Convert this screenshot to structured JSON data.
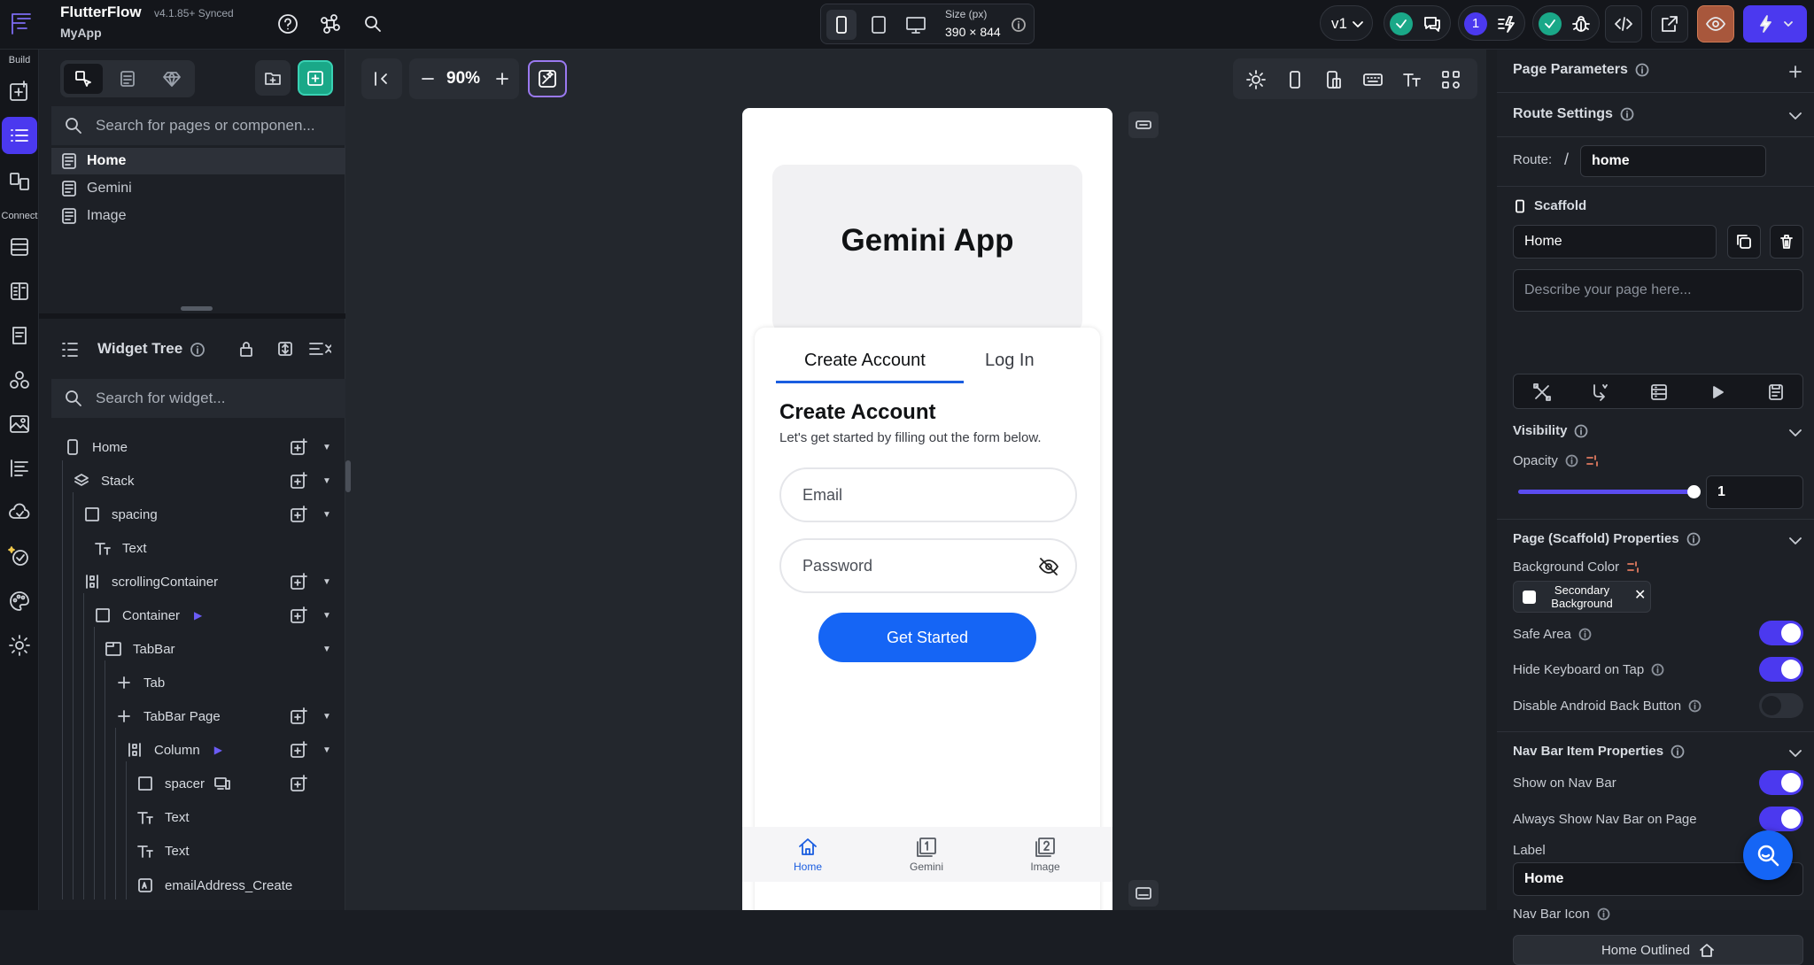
{
  "app": {
    "title": "FlutterFlow",
    "version": "v4.1.85+ Synced",
    "project": "MyApp"
  },
  "topbar": {
    "size_label": "Size (px)",
    "size_value": "390 × 844",
    "version_select": "v1",
    "badge_count": "1"
  },
  "rail": {
    "build_label": "Build",
    "connect_label": "Connect"
  },
  "pages_panel": {
    "search_placeholder": "Search for pages or componen...",
    "pages": [
      {
        "label": "Home",
        "active": true
      },
      {
        "label": "Gemini",
        "active": false
      },
      {
        "label": "Image",
        "active": false
      }
    ]
  },
  "widget_tree": {
    "title": "Widget Tree",
    "search_placeholder": "Search for widget...",
    "rows": [
      {
        "label": "Home"
      },
      {
        "label": "Stack"
      },
      {
        "label": "spacing"
      },
      {
        "label": "Text"
      },
      {
        "label": "scrollingContainer"
      },
      {
        "label": "Container"
      },
      {
        "label": "TabBar"
      },
      {
        "label": "Tab"
      },
      {
        "label": "TabBar Page"
      },
      {
        "label": "Column"
      },
      {
        "label": "spacer"
      },
      {
        "label": "Text"
      },
      {
        "label": "Text"
      },
      {
        "label": "emailAddress_Create"
      }
    ]
  },
  "canvas": {
    "zoom": "90%"
  },
  "phone": {
    "hero_title": "Gemini App",
    "tabs": [
      "Create Account",
      "Log In"
    ],
    "form_title": "Create Account",
    "form_subtitle": "Let's get started by filling out the form below.",
    "email_placeholder": "Email",
    "password_placeholder": "Password",
    "cta": "Get Started",
    "nav": [
      {
        "label": "Home"
      },
      {
        "label": "Gemini"
      },
      {
        "label": "Image"
      }
    ]
  },
  "properties": {
    "page_parameters": "Page Parameters",
    "route_settings": "Route Settings",
    "route_label": "Route:",
    "route_slash": "/",
    "route_value": "home",
    "scaffold_label": "Scaffold",
    "scaffold_name": "Home",
    "describe_placeholder": "Describe your page here...",
    "visibility": "Visibility",
    "opacity_label": "Opacity",
    "opacity_value": "1",
    "opacity_fraction": 1.0,
    "scaffold_props": "Page (Scaffold) Properties",
    "bg_color_label": "Background Color",
    "bg_color_value": "Secondary Background",
    "safe_area": "Safe Area",
    "hide_keyboard": "Hide Keyboard on Tap",
    "disable_back": "Disable Android Back Button",
    "nav_bar_props": "Nav Bar Item Properties",
    "show_on_nav": "Show on Nav Bar",
    "always_show_nav": "Always Show Nav Bar on Page",
    "label_label": "Label",
    "label_value": "Home",
    "nav_icon_label": "Nav Bar Icon",
    "nav_icon_value": "Home Outlined"
  },
  "colors": {
    "accent": "#4b39ef",
    "primary_blue": "#1565f5",
    "green": "#1aa888"
  }
}
